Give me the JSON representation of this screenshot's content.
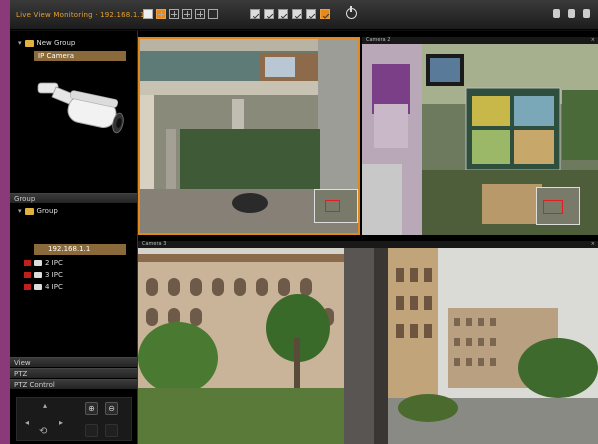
{
  "titlebar": {
    "app_title": "Live View Monitoring · 192.168.1.1"
  },
  "sidebar": {
    "tree_root": "New Group",
    "tree_selected": "IP Camera",
    "section_groups": "Group",
    "group_name": "Group",
    "cameras": [
      {
        "label": "192.168.1.1"
      },
      {
        "label": "2 IPC"
      },
      {
        "label": "3 IPC"
      },
      {
        "label": "4 IPC"
      }
    ],
    "menu": [
      "View",
      "PTZ",
      "PTZ Control"
    ]
  },
  "tiles": [
    {
      "header": "Camera 1"
    },
    {
      "header": "Camera 2"
    },
    {
      "header": "Camera 3"
    }
  ]
}
